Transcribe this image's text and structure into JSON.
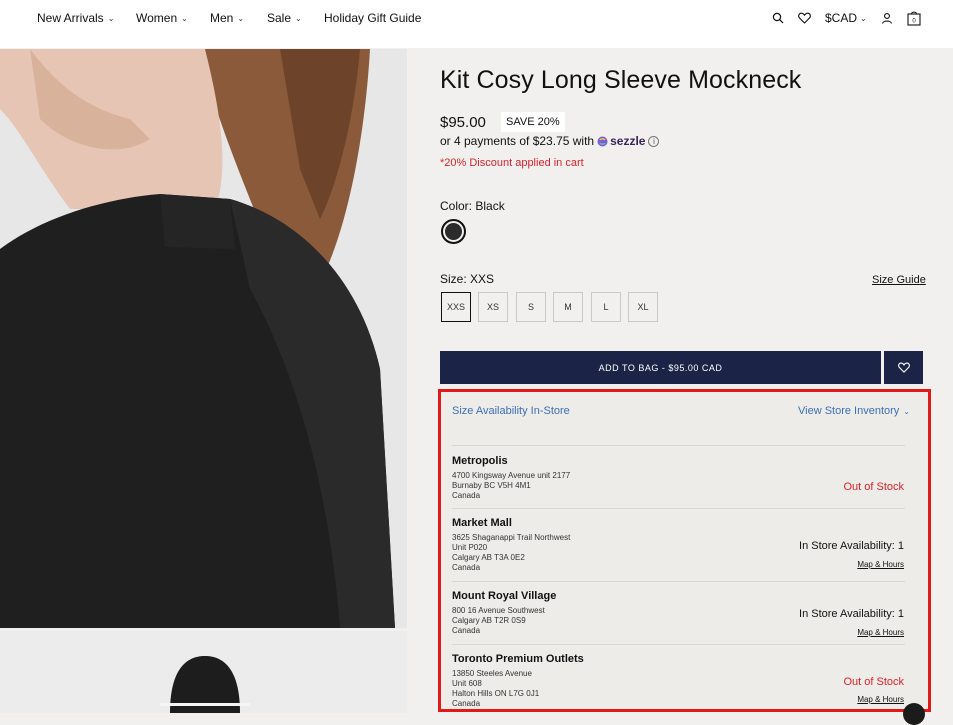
{
  "nav": {
    "items": [
      "New Arrivals",
      "Women",
      "Men",
      "Sale",
      "Holiday Gift Guide"
    ],
    "currency": "$CAD",
    "cart_count": "0"
  },
  "product": {
    "title": "Kit Cosy Long Sleeve Mockneck",
    "price": "$95.00",
    "save_badge": "SAVE 20%",
    "payments_text": "or 4 payments of $23.75 with",
    "sezzle_label": "sezzle",
    "discount_note": "*20% Discount applied in cart",
    "color_label": "Color: Black",
    "swatch_color": "#2b2b2b",
    "size_label": "Size: XXS",
    "size_guide": "Size Guide",
    "sizes": [
      "XXS",
      "XS",
      "S",
      "M",
      "L",
      "XL"
    ],
    "selected_size": "XXS",
    "add_to_bag": "ADD TO BAG - $95.00 CAD"
  },
  "availability": {
    "heading": "Size Availability In-Store",
    "view_inventory": "View Store Inventory",
    "stores": [
      {
        "name": "Metropolis",
        "address": [
          "4700 Kingsway Avenue unit 2177",
          "Burnaby BC V5H 4M1",
          "Canada"
        ],
        "status": "Out of Stock",
        "map_link": ""
      },
      {
        "name": "Market Mall",
        "address": [
          "3625 Shaganappi Trail Northwest",
          "Unit P020",
          "Calgary AB T3A 0E2",
          "Canada"
        ],
        "status": "In Store Availability: 1",
        "map_link": "Map & Hours"
      },
      {
        "name": "Mount Royal Village",
        "address": [
          "800 16 Avenue Southwest",
          "Calgary AB T2R 0S9",
          "Canada"
        ],
        "status": "In Store Availability: 1",
        "map_link": "Map & Hours"
      },
      {
        "name": "Toronto Premium Outlets",
        "address": [
          "13850 Steeles Avenue",
          "Unit 608",
          "Halton Hills ON L7G 0J1",
          "Canada"
        ],
        "status": "Out of Stock",
        "map_link": "Map & Hours"
      }
    ]
  },
  "colors": {
    "navy": "#1b2346",
    "accent_red": "#d9232a",
    "link_blue": "#3b6fb6",
    "highlight_border": "#e01919"
  }
}
